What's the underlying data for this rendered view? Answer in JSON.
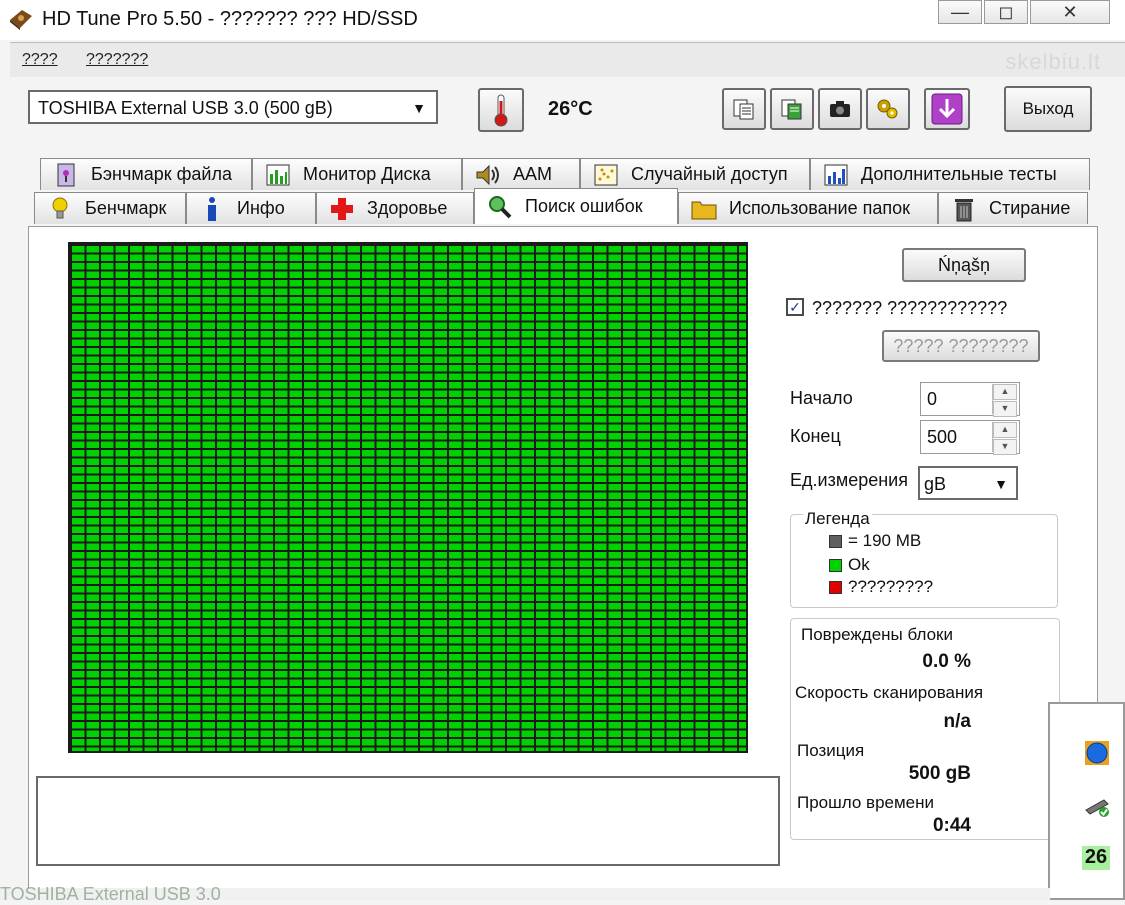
{
  "window": {
    "title": "HD Tune Pro 5.50 - ??????? ??? HD/SSD"
  },
  "menu": {
    "items": [
      "????",
      "???????"
    ],
    "watermark": "skelbiu.lt"
  },
  "toolbar": {
    "drive": "TOSHIBA External USB 3.0 (500 gB)",
    "temperature": "26°C",
    "exit_label": "Выход"
  },
  "tabs": {
    "row1": [
      "Бэнчмарк файла",
      "Монитор Диска",
      "AAM",
      "Случайный доступ",
      "Дополнительные тесты"
    ],
    "row2": [
      "Бенчмарк",
      "Инфо",
      "Здоровье",
      "Поиск ошибок",
      "Использование папок",
      "Стирание"
    ],
    "active": "Поиск ошибок"
  },
  "scan": {
    "start_button": "Ńņąšņ",
    "quick_scan_label": "??????? ????????????",
    "quick_scan_checked": true,
    "secondary_button": "????? ????????",
    "start_label": "Начало",
    "start_value": "0",
    "end_label": "Конец",
    "end_value": "500",
    "unit_label": "Ед.измерения",
    "unit_value": "gB"
  },
  "legend": {
    "title": "Легенда",
    "items": [
      {
        "color": "#606060",
        "label": "= 190 MB"
      },
      {
        "color": "#00d200",
        "label": "Ok"
      },
      {
        "color": "#e00000",
        "label": "?????????"
      }
    ]
  },
  "stats": {
    "damaged_label": "Повреждены блоки",
    "damaged_value": "0.0 %",
    "speed_label": "Скорость сканирования",
    "speed_value": "n/a",
    "position_label": "Позиция",
    "position_value": "500 gB",
    "elapsed_label": "Прошло времени",
    "elapsed_value": "0:44"
  },
  "tray": {
    "temp": "26"
  },
  "background": {
    "ghost_text": "TOSHIBA External USB 3.0"
  },
  "colors": {
    "ok": "#00d200",
    "accent_purple": "#a040c0"
  }
}
